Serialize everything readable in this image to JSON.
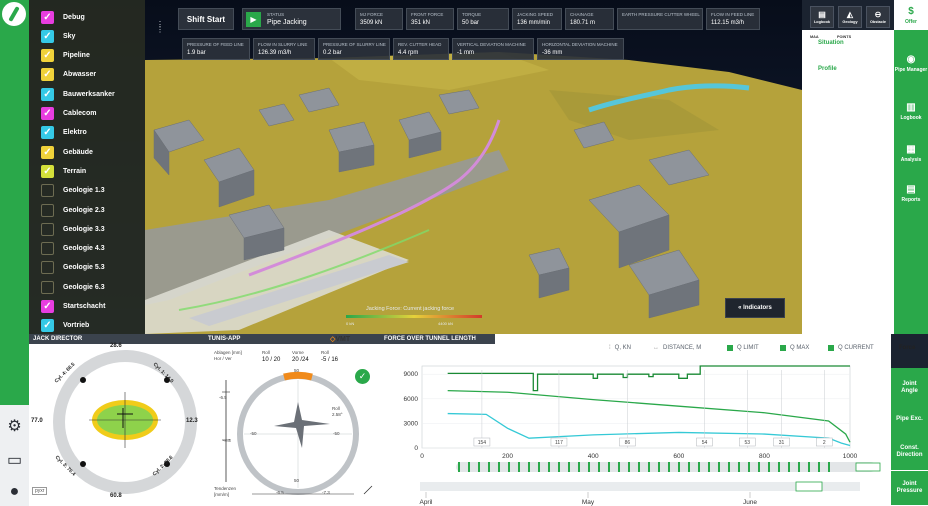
{
  "layers": [
    {
      "label": "Debug",
      "checked": true,
      "color": "#e83de0"
    },
    {
      "label": "Sky",
      "checked": true,
      "color": "#35c9e6"
    },
    {
      "label": "Pipeline",
      "checked": true,
      "color": "#f0d23a"
    },
    {
      "label": "Abwasser",
      "checked": true,
      "color": "#f0d23a"
    },
    {
      "label": "Bauwerksanker",
      "checked": true,
      "color": "#35c9e6"
    },
    {
      "label": "Cablecom",
      "checked": true,
      "color": "#e83de0"
    },
    {
      "label": "Elektro",
      "checked": true,
      "color": "#35c9e6"
    },
    {
      "label": "Gebäude",
      "checked": true,
      "color": "#f0d23a"
    },
    {
      "label": "Terrain",
      "checked": true,
      "color": "#d4e03a"
    },
    {
      "label": "Geologie 1.3",
      "checked": false,
      "color": ""
    },
    {
      "label": "Geologie 2.3",
      "checked": false,
      "color": ""
    },
    {
      "label": "Geologie 3.3",
      "checked": false,
      "color": ""
    },
    {
      "label": "Geologie 4.3",
      "checked": false,
      "color": ""
    },
    {
      "label": "Geologie 5.3",
      "checked": false,
      "color": ""
    },
    {
      "label": "Geologie 6.3",
      "checked": false,
      "color": ""
    },
    {
      "label": "Startschacht",
      "checked": true,
      "color": "#e83de0"
    },
    {
      "label": "Vortrieb",
      "checked": true,
      "color": "#35c9e6"
    }
  ],
  "top": {
    "shift_label": "Shift Start",
    "status_key": "STATUS",
    "status_value": "Pipe Jacking",
    "chips_row1": [
      {
        "k": "MJ Force",
        "v": "3509 kN"
      },
      {
        "k": "Front Force",
        "v": "351 kN"
      },
      {
        "k": "Torque",
        "v": "50 bar"
      },
      {
        "k": "Jacking Speed",
        "v": "136 mm/min"
      },
      {
        "k": "Chainage",
        "v": "180.71 m"
      },
      {
        "k": "Earth Pressure Cutter Wheel",
        "v": ""
      },
      {
        "k": "Flow in Feed Line",
        "v": "112.15 m3/h"
      }
    ],
    "chips_row2": [
      {
        "k": "Pressure of Feed Line",
        "v": "1.9 bar"
      },
      {
        "k": "Flow in Slurry Line",
        "v": "126.39 m3/h"
      },
      {
        "k": "Pressure of Slurry Line",
        "v": "0.2 bar"
      },
      {
        "k": "Rev. Cutter Head",
        "v": "4.4 rpm"
      },
      {
        "k": "Vertical Deviation Machine",
        "v": "-1 mm"
      },
      {
        "k": "Horizontal Deviation Machine",
        "v": "-36 mm"
      }
    ]
  },
  "tools": [
    {
      "icon": "▤",
      "label": "Logbook"
    },
    {
      "icon": "◭",
      "label": "Geology"
    },
    {
      "icon": "⊖",
      "label": "Obstacle"
    },
    {
      "icon": "$",
      "label": "Offer"
    }
  ],
  "subpanel": {
    "tab1": "MAA",
    "tab2": "POINTS",
    "item1": "Situation",
    "item2": "Profile"
  },
  "nav": [
    {
      "icon": "◉",
      "label": "Pipe Manager"
    },
    {
      "icon": "▥",
      "label": "Logbook"
    },
    {
      "icon": "▦",
      "label": "Analysis"
    },
    {
      "icon": "▤",
      "label": "Reports"
    }
  ],
  "scene": {
    "jacking_force_label": "Jacking Force: Current jacking force",
    "jf_min": "0 kN",
    "jf_max": "4400 kN",
    "indicators_label": "Indicators"
  },
  "jack_director": {
    "title": "JACK DIRECTOR",
    "top": "28.6",
    "left": "77.0",
    "right": "12.3",
    "bottom": "60.8",
    "cyl_tl": "Cyl. 4: 66.5",
    "cyl_tr": "Cyl. 1: 14.0",
    "cyl_bl": "Cyl. 3: 76.4",
    "cyl_br": "Cyl. 2: 38.6"
  },
  "tunis": {
    "title": "TUNIS-APP",
    "ablagen_label": "Ablagen [mm]",
    "hor_ver": "Hor / Ver",
    "roll_label": "Roll",
    "roll_val": "10 / 20",
    "vorne_label": "Vorne",
    "vorne_val": "20 /24",
    "roll2_label": "Roll",
    "roll2_val": "-5 / 16",
    "dial_top": "50",
    "dial_left": "-50",
    "dial_right": "-50",
    "dial_bottom": "50",
    "roll_readout_label": "Roll",
    "roll_readout_val": "2.58°",
    "ruler_a": "-6.5",
    "ruler_b": "-4.3",
    "tend_label": "Tendenzen",
    "tend_unit": "[mm/m]",
    "tend_a": "-6.5",
    "tend_b": "-7.3",
    "vmt_logo": "VMT"
  },
  "force": {
    "title": "FORCE OVER TUNNEL LENGTH",
    "tab_force": "Force",
    "legend": [
      {
        "label": "Q, KN",
        "marker": "line"
      },
      {
        "label": "DISTANCE, M",
        "marker": "arrow"
      },
      {
        "label": "Q LIMIT",
        "marker": "square"
      },
      {
        "label": "Q MAX",
        "marker": "square"
      },
      {
        "label": "Q CURRENT",
        "marker": "square"
      }
    ],
    "colors": {
      "limit": "#1a8a34",
      "max": "#2aa84a",
      "current": "#35c9d6"
    },
    "months": [
      "April",
      "May",
      "June"
    ],
    "timeline_label": "III"
  },
  "chart_data": {
    "type": "line",
    "xlabel": "",
    "ylabel": "",
    "xlim": [
      0,
      1000
    ],
    "ylim": [
      0,
      10000
    ],
    "x_ticks": [
      0,
      200,
      400,
      600,
      800,
      1000
    ],
    "y_ticks": [
      0,
      3000,
      6000,
      9000
    ],
    "y_tick_labels": [
      "0",
      "3000",
      "6000",
      "9000"
    ],
    "series": [
      {
        "name": "Q LIMIT",
        "x": [
          60,
          260,
          260,
          270,
          270,
          400,
          400,
          410,
          410,
          470,
          470,
          480,
          480,
          530,
          530,
          540,
          540,
          600,
          600,
          620,
          620,
          650,
          650,
          1000
        ],
        "y": [
          9100,
          9100,
          7000,
          7000,
          9000,
          9000,
          8500,
          8500,
          9000,
          9000,
          8600,
          8600,
          9000,
          9000,
          8700,
          8700,
          9000,
          9000,
          8500,
          8500,
          9000,
          9000,
          11000,
          11000
        ]
      },
      {
        "name": "Q MAX",
        "x": [
          60,
          200,
          400,
          600,
          800,
          950,
          990,
          1000
        ],
        "y": [
          7000,
          6800,
          5900,
          5100,
          4300,
          3300,
          1700,
          700
        ]
      },
      {
        "name": "Q CURRENT",
        "x": [
          60,
          150,
          200,
          250,
          400,
          600,
          800,
          950,
          980,
          1000
        ],
        "y": [
          4200,
          4100,
          2400,
          1200,
          1600,
          1900,
          1700,
          1200,
          600,
          300
        ]
      }
    ],
    "marker_labels": [
      "154",
      "117",
      "86",
      "54",
      "53",
      "31",
      "2"
    ]
  }
}
